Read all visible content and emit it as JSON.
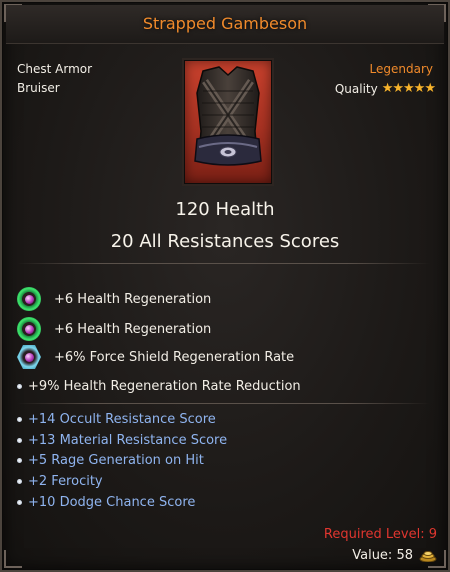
{
  "item": {
    "name": "Strapped Gambeson",
    "slot": "Chest Armor",
    "class": "Bruiser",
    "rarity": "Legendary",
    "quality_label": "Quality",
    "quality_stars": 5,
    "stars_text": "★★★★★"
  },
  "main_stats": [
    "120 Health",
    "20 All Resistances Scores"
  ],
  "gem_stats": [
    {
      "text": "+6 Health Regeneration",
      "icon": "green-round-gem-icon"
    },
    {
      "text": "+6 Health Regeneration",
      "icon": "green-round-gem-icon"
    },
    {
      "text": "+6% Force Shield Regeneration Rate",
      "icon": "blue-hexagon-gem-icon"
    }
  ],
  "special_stat": "+9% Health Regeneration Rate Reduction",
  "bonus_stats": [
    "+14 Occult Resistance Score",
    "+13 Material Resistance Score",
    "+5 Rage Generation on Hit",
    "+2 Ferocity",
    "+10 Dodge Chance Score"
  ],
  "requirements": {
    "required_level": "Required Level: 9",
    "value": "Value: 58"
  },
  "colors": {
    "legendary": "#f08a2b",
    "bonus_text": "#8fb4ef",
    "requirement": "#e0362f",
    "star": "#f7b32b"
  }
}
